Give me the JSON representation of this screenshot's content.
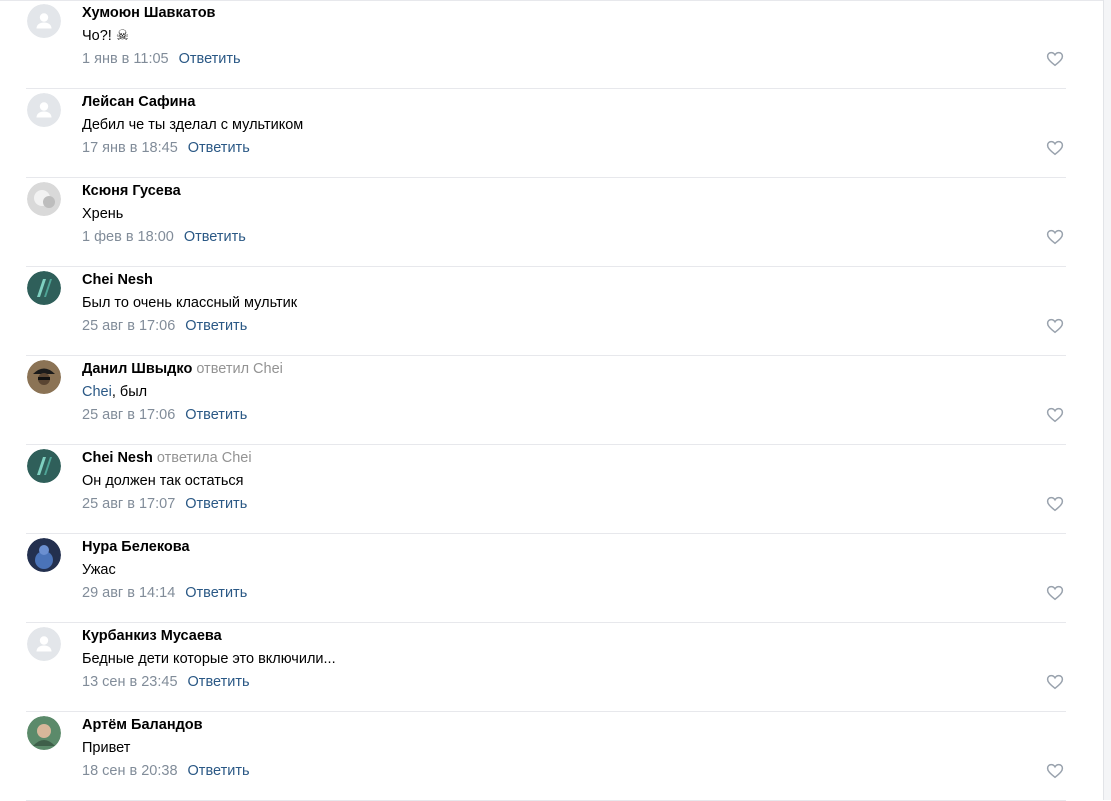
{
  "comments": [
    {
      "author": "Хумоюн Шавкатов",
      "replied_to": "",
      "mention": "",
      "text": "Чо?! ☠",
      "date": "1 янв в 11:05",
      "reply_label": "Ответить",
      "avatar": "default-avatar"
    },
    {
      "author": "Лейсан Сафина",
      "replied_to": "",
      "mention": "",
      "text": "Дебил че ты зделал с мультиком",
      "date": "17 янв в 18:45",
      "reply_label": "Ответить",
      "avatar": "default-avatar"
    },
    {
      "author": "Ксюня Гусева",
      "replied_to": "",
      "mention": "",
      "text": "Хрень",
      "date": "1 фев в 18:00",
      "reply_label": "Ответить",
      "avatar": "photo-grey"
    },
    {
      "author": "Chei Nesh",
      "replied_to": "",
      "mention": "",
      "text": "Был то очень классный мультик",
      "date": "25 авг в 17:06",
      "reply_label": "Ответить",
      "avatar": "photo-teal"
    },
    {
      "author": "Данил Швыдко",
      "replied_to": "ответил Chei",
      "mention": "Chei",
      "text": ", был",
      "date": "25 авг в 17:06",
      "reply_label": "Ответить",
      "avatar": "photo-dark"
    },
    {
      "author": "Chei Nesh",
      "replied_to": "ответила Chei",
      "mention": "",
      "text": "Он должен так остаться",
      "date": "25 авг в 17:07",
      "reply_label": "Ответить",
      "avatar": "photo-teal"
    },
    {
      "author": "Нура Белекова",
      "replied_to": "",
      "mention": "",
      "text": "Ужас",
      "date": "29 авг в 14:14",
      "reply_label": "Ответить",
      "avatar": "photo-blue"
    },
    {
      "author": "Курбанкиз Мусаева",
      "replied_to": "",
      "mention": "",
      "text": "Бедные дети которые это включили...",
      "date": "13 сен в 23:45",
      "reply_label": "Ответить",
      "avatar": "default-avatar"
    },
    {
      "author": "Артём Баландов",
      "replied_to": "",
      "mention": "",
      "text": "Привет",
      "date": "18 сен в 20:38",
      "reply_label": "Ответить",
      "avatar": "photo-green"
    }
  ],
  "colors": {
    "link": "#2a5885",
    "muted": "#818c99",
    "divider": "#e7e8ec"
  },
  "icons": {
    "like": "heart-outline-icon"
  }
}
